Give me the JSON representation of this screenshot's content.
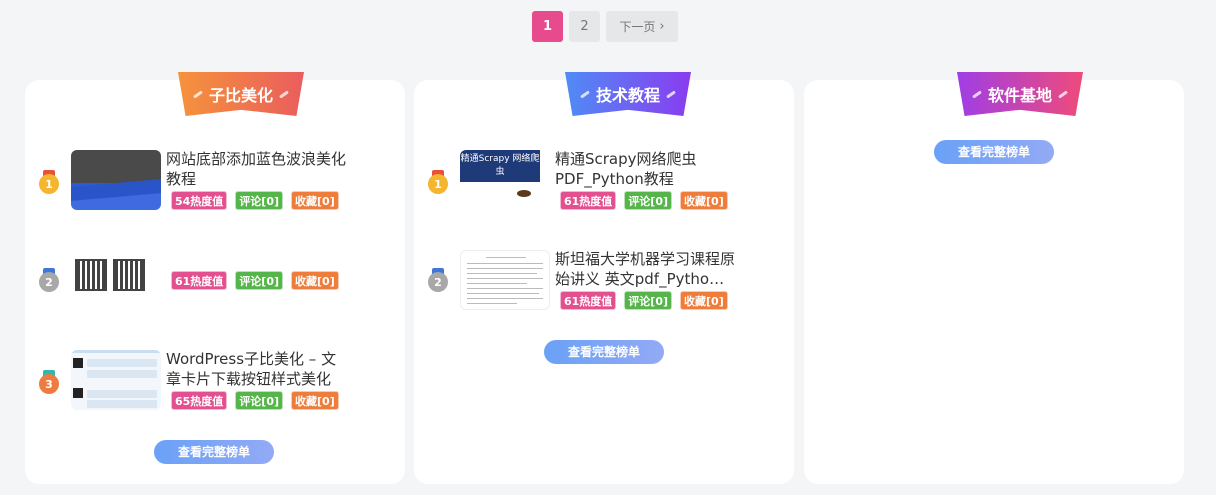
{
  "pagination": {
    "pages": [
      "1",
      "2"
    ],
    "current": "1",
    "next_label": "下一页",
    "next_icon": "chevron-right-icon"
  },
  "cards": [
    {
      "title": "子比美化",
      "items": [
        {
          "rank": "1",
          "title": "网站底部添加蓝色波浪美化教程",
          "hot": "54热度值",
          "comments": "评论[0]",
          "favorites": "收藏[0]"
        },
        {
          "rank": "2",
          "title": "",
          "hot": "61热度值",
          "comments": "评论[0]",
          "favorites": "收藏[0]"
        },
        {
          "rank": "3",
          "title": "WordPress子比美化 – 文章卡片下载按钮样式美化",
          "hot": "65热度值",
          "comments": "评论[0]",
          "favorites": "收藏[0]"
        }
      ],
      "full_label": "查看完整榜单"
    },
    {
      "title": "技术教程",
      "items": [
        {
          "rank": "1",
          "title": "精通Scrapy网络爬虫PDF_Python教程",
          "hot": "61热度值",
          "comments": "评论[0]",
          "favorites": "收藏[0]",
          "thumb_text": "精通Scrapy 网络爬虫"
        },
        {
          "rank": "2",
          "title": "斯坦福大学机器学习课程原始讲义 英文pdf_Pytho…",
          "hot": "61热度值",
          "comments": "评论[0]",
          "favorites": "收藏[0]"
        }
      ],
      "full_label": "查看完整榜单"
    },
    {
      "title": "软件基地",
      "items": [],
      "full_label": "查看完整榜单"
    }
  ],
  "colors": {
    "active_page": "#e74b8d",
    "hot_tag": "#e2508f",
    "comment_tag": "#55b44a",
    "favorite_tag": "#ee7c3a",
    "button": "#6aa1f7"
  }
}
